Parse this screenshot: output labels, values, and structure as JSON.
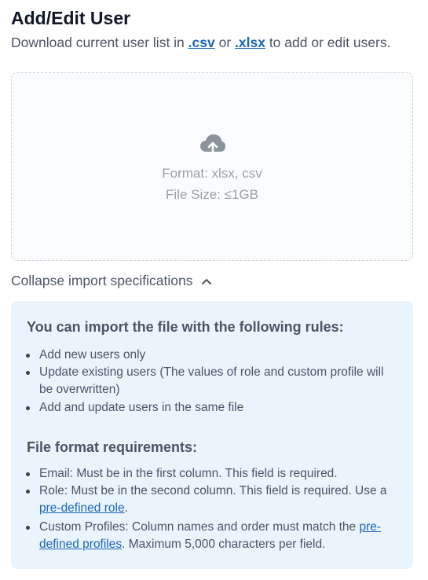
{
  "header": {
    "title": "Add/Edit User",
    "subtitle_prefix": "Download current user list in ",
    "csv_link": ".csv",
    "or_text": " or ",
    "xlsx_link": ".xlsx",
    "subtitle_suffix": " to add or edit users."
  },
  "dropzone": {
    "icon": "cloud-upload-icon",
    "format": "Format: xlsx, csv",
    "size": "File Size: ≤1GB"
  },
  "collapse": {
    "label": "Collapse import specifications",
    "icon": "chevron-up-icon"
  },
  "specs": {
    "rules_heading": "You can import the file with the following rules:",
    "rules": [
      "Add new users only",
      "Update existing users (The values of role and custom profile will be overwritten)",
      "Add and update users in the same file"
    ],
    "format_heading": "File format requirements:",
    "email_req": "Email: Must be in the first column. This field is required.",
    "role_req_text": "Role: Must be in the second column. This field is required. Use a ",
    "role_req_link": "pre-defined role",
    "role_req_end": ".",
    "profiles_req_text": "Custom Profiles: Column names and order must match the ",
    "profiles_req_link": "pre-defined profiles",
    "profiles_req_end": ". Maximum 5,000 characters per field."
  },
  "colors": {
    "link": "#1766b9",
    "spec_background": "#eaf4fc",
    "muted_text": "#9aa1a9"
  }
}
